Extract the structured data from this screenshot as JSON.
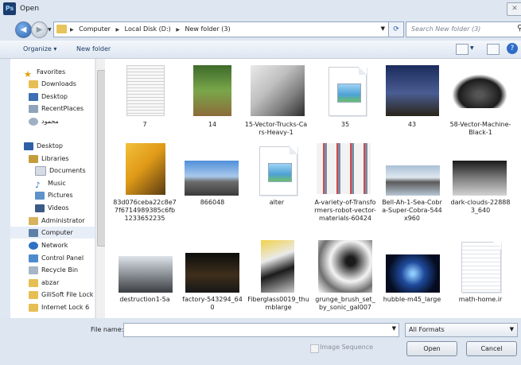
{
  "window": {
    "title": "Open",
    "app_icon": "Ps",
    "close_glyph": "✕"
  },
  "address": {
    "crumbs": [
      "Computer",
      "Local Disk (D:)",
      "New folder (3)"
    ],
    "search_placeholder": "Search New folder (3)"
  },
  "toolbar": {
    "organize": "Organize ▾",
    "new_folder": "New folder"
  },
  "sidebar": {
    "favorites": "Favorites",
    "items_fav": [
      "Downloads",
      "Desktop",
      "RecentPlaces",
      "محمود"
    ],
    "desktop": "Desktop",
    "libraries": "Libraries",
    "lib_items": [
      "Documents",
      "Music",
      "Pictures",
      "Videos"
    ],
    "more": [
      "Administrator",
      "Computer",
      "Network",
      "Control Panel",
      "Recycle Bin",
      "abzar",
      "GiliSoft File Lock",
      "Internet Lock 6"
    ]
  },
  "files": [
    "7",
    "14",
    "15-Vector-Trucks-Cars-Heavy-1",
    "35",
    "43",
    "58-Vector-Machine-Black-1",
    "83d076ceba22c8e77f6714989385c6fb1233652235",
    "866048",
    "alter",
    "A-variety-of-Transformers-robot-vector-materials-60424",
    "Bell-Ah-1-Sea-Cobra-Super-Cobra-544x960",
    "dark-clouds-228883_640",
    "destruction1-5a",
    "factory-543294_640",
    "Fiberglass0019_thumblarge",
    "grunge_brush_set_by_sonic_gal007",
    "hubble-m45_large",
    "math-home.ir"
  ],
  "bottom": {
    "file_name_label": "File name:",
    "file_name_value": "",
    "filter": "All Formats",
    "image_sequence": "Image Sequence",
    "open": "Open",
    "cancel": "Cancel"
  }
}
